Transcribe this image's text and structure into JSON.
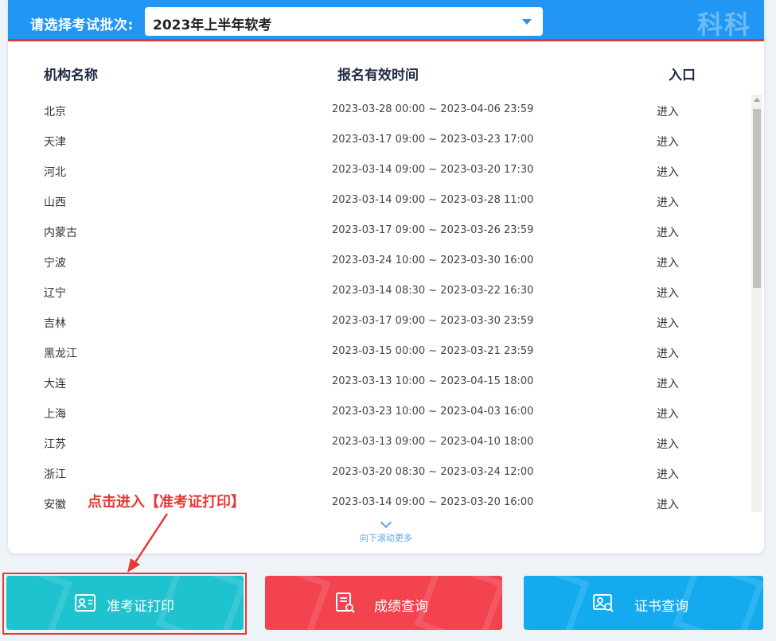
{
  "header": {
    "select_label": "请选择考试批次:",
    "selected_batch": "2023年上半年软考",
    "watermark": "科科过"
  },
  "table": {
    "columns": [
      "机构名称",
      "报名有效时间",
      "入口"
    ],
    "rows": [
      {
        "name": "北京",
        "time": "2023-03-28 00:00 ~ 2023-04-06 23:59",
        "entry": "进入"
      },
      {
        "name": "天津",
        "time": "2023-03-17 09:00 ~ 2023-03-23 17:00",
        "entry": "进入"
      },
      {
        "name": "河北",
        "time": "2023-03-14 09:00 ~ 2023-03-20 17:30",
        "entry": "进入"
      },
      {
        "name": "山西",
        "time": "2023-03-14 09:00 ~ 2023-03-28 11:00",
        "entry": "进入"
      },
      {
        "name": "内蒙古",
        "time": "2023-03-17 09:00 ~ 2023-03-26 23:59",
        "entry": "进入"
      },
      {
        "name": "宁波",
        "time": "2023-03-24 10:00 ~ 2023-03-30 16:00",
        "entry": "进入"
      },
      {
        "name": "辽宁",
        "time": "2023-03-14 08:30 ~ 2023-03-22 16:30",
        "entry": "进入"
      },
      {
        "name": "吉林",
        "time": "2023-03-17 09:00 ~ 2023-03-30 23:59",
        "entry": "进入"
      },
      {
        "name": "黑龙江",
        "time": "2023-03-15 00:00 ~ 2023-03-21 23:59",
        "entry": "进入"
      },
      {
        "name": "大连",
        "time": "2023-03-13 10:00 ~ 2023-04-15 18:00",
        "entry": "进入"
      },
      {
        "name": "上海",
        "time": "2023-03-23 10:00 ~ 2023-04-03 16:00",
        "entry": "进入"
      },
      {
        "name": "江苏",
        "time": "2023-03-13 09:00 ~ 2023-04-10 18:00",
        "entry": "进入"
      },
      {
        "name": "浙江",
        "time": "2023-03-20 08:30 ~ 2023-03-24 12:00",
        "entry": "进入"
      },
      {
        "name": "安徽",
        "time": "2023-03-14 09:00 ~ 2023-03-20 16:00",
        "entry": "进入"
      }
    ],
    "scroll_more": "向下滚动更多"
  },
  "annotation": "点击进入【准考证打印】",
  "buttons": {
    "admit": "准考证打印",
    "score": "成绩查询",
    "cert": "证书查询"
  },
  "colors": {
    "header_blue": "#2196f3",
    "accent_red": "#e53935",
    "admit_teal": "#1fc2cf",
    "score_red": "#f2434f",
    "cert_blue": "#13aaf0"
  }
}
